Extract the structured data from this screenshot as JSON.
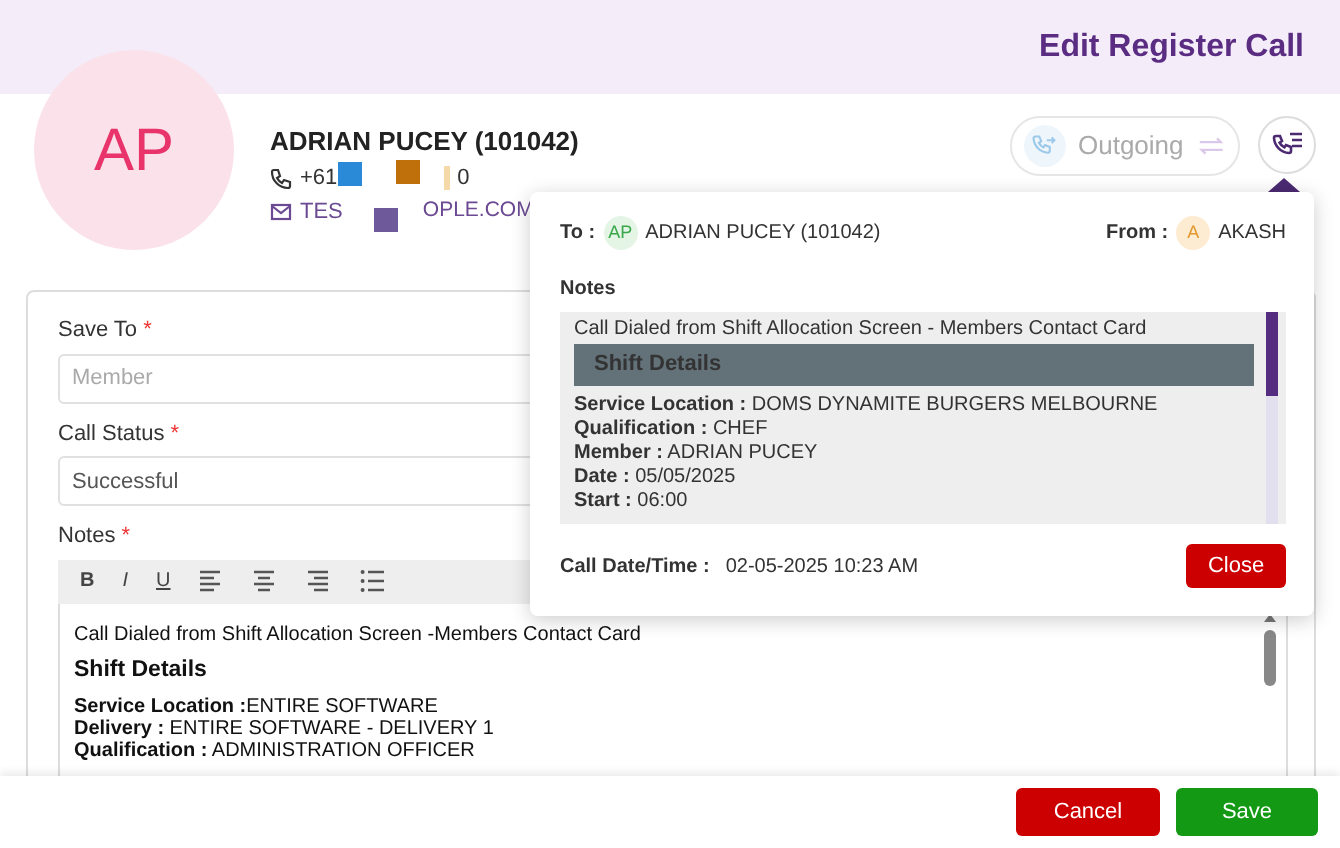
{
  "header": {
    "title": "Edit Register Call"
  },
  "contact": {
    "initials": "AP",
    "name": "ADRIAN PUCEY (101042)",
    "phone": [
      "+61",
      "0"
    ],
    "email": [
      "TES",
      "OPLE.COM"
    ]
  },
  "redactions": [
    {
      "color": "#2a8ad8"
    },
    {
      "color": "#c0700a"
    },
    {
      "color": "#f5d9a8"
    },
    {
      "color": "#6e5a9a"
    }
  ],
  "direction": {
    "label": "Outgoing",
    "disabled": true
  },
  "form": {
    "fields": [
      {
        "label": "Save To",
        "required_mark": "*",
        "placeholder": "Member"
      },
      {
        "label": "Call Status",
        "required_mark": "*",
        "value": "Successful"
      }
    ],
    "notes_label": "Notes",
    "notes_required_mark": "*",
    "toolbar": [
      {
        "kind": "bold",
        "label": "B"
      },
      {
        "kind": "italic",
        "label": "I"
      },
      {
        "kind": "underline",
        "label": "U"
      },
      {
        "kind": "align-left"
      },
      {
        "kind": "align-center"
      },
      {
        "kind": "align-right"
      },
      {
        "kind": "list"
      }
    ],
    "editor": {
      "intro": "Call Dialed from Shift Allocation Screen -Members Contact Card",
      "heading": "Shift Details",
      "lines": [
        "**Service Location :**ENTIRE SOFTWARE",
        "**Delivery :** ENTIRE SOFTWARE - DELIVERY 1",
        "**Qualification :** ADMINISTRATION OFFICER"
      ]
    }
  },
  "popover": {
    "to_label": "To :",
    "to_initials": "AP",
    "to_name": "ADRIAN PUCEY (101042)",
    "from_label": "From :",
    "from_initials": "A",
    "from_name": "AKASH",
    "notes_label": "Notes",
    "intro": "Call Dialed from Shift Allocation Screen - Members Contact Card",
    "heading": "Shift Details",
    "lines": [
      "**Service Location :** DOMS DYNAMITE BURGERS MELBOURNE",
      "**Qualification :** CHEF",
      "**Member :** ADRIAN PUCEY",
      "**Date :** 05/05/2025",
      "**Start :** 06:00"
    ],
    "datetime_label": "Call Date/Time :",
    "datetime": "02-05-2025 10:23 AM",
    "close": "Close"
  },
  "buttons": [
    {
      "label": "Cancel",
      "kind": "cancel"
    },
    {
      "label": "Save",
      "kind": "save"
    }
  ]
}
